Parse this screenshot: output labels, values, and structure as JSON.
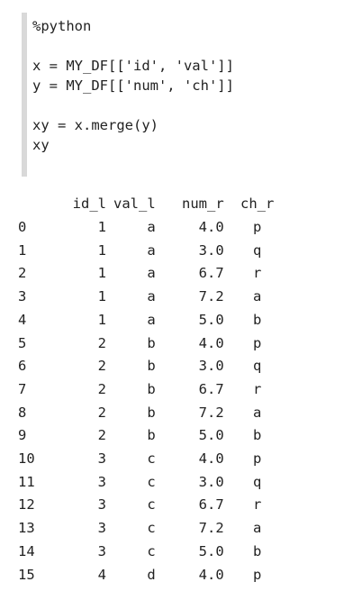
{
  "code_cell": {
    "lines": [
      "%python",
      "",
      "x = MY_DF[['id', 'val']]",
      "y = MY_DF[['num', 'ch']]",
      "",
      "xy = x.merge(y)",
      "xy"
    ]
  },
  "output_table": {
    "headers": [
      "",
      "id_l",
      "val_l",
      "num_r",
      "ch_r"
    ],
    "rows": [
      [
        "0",
        "1",
        "a",
        "4.0",
        "p"
      ],
      [
        "1",
        "1",
        "a",
        "3.0",
        "q"
      ],
      [
        "2",
        "1",
        "a",
        "6.7",
        "r"
      ],
      [
        "3",
        "1",
        "a",
        "7.2",
        "a"
      ],
      [
        "4",
        "1",
        "a",
        "5.0",
        "b"
      ],
      [
        "5",
        "2",
        "b",
        "4.0",
        "p"
      ],
      [
        "6",
        "2",
        "b",
        "3.0",
        "q"
      ],
      [
        "7",
        "2",
        "b",
        "6.7",
        "r"
      ],
      [
        "8",
        "2",
        "b",
        "7.2",
        "a"
      ],
      [
        "9",
        "2",
        "b",
        "5.0",
        "b"
      ],
      [
        "10",
        "3",
        "c",
        "4.0",
        "p"
      ],
      [
        "11",
        "3",
        "c",
        "3.0",
        "q"
      ],
      [
        "12",
        "3",
        "c",
        "6.7",
        "r"
      ],
      [
        "13",
        "3",
        "c",
        "7.2",
        "a"
      ],
      [
        "14",
        "3",
        "c",
        "5.0",
        "b"
      ],
      [
        "15",
        "4",
        "d",
        "4.0",
        "p"
      ]
    ]
  }
}
